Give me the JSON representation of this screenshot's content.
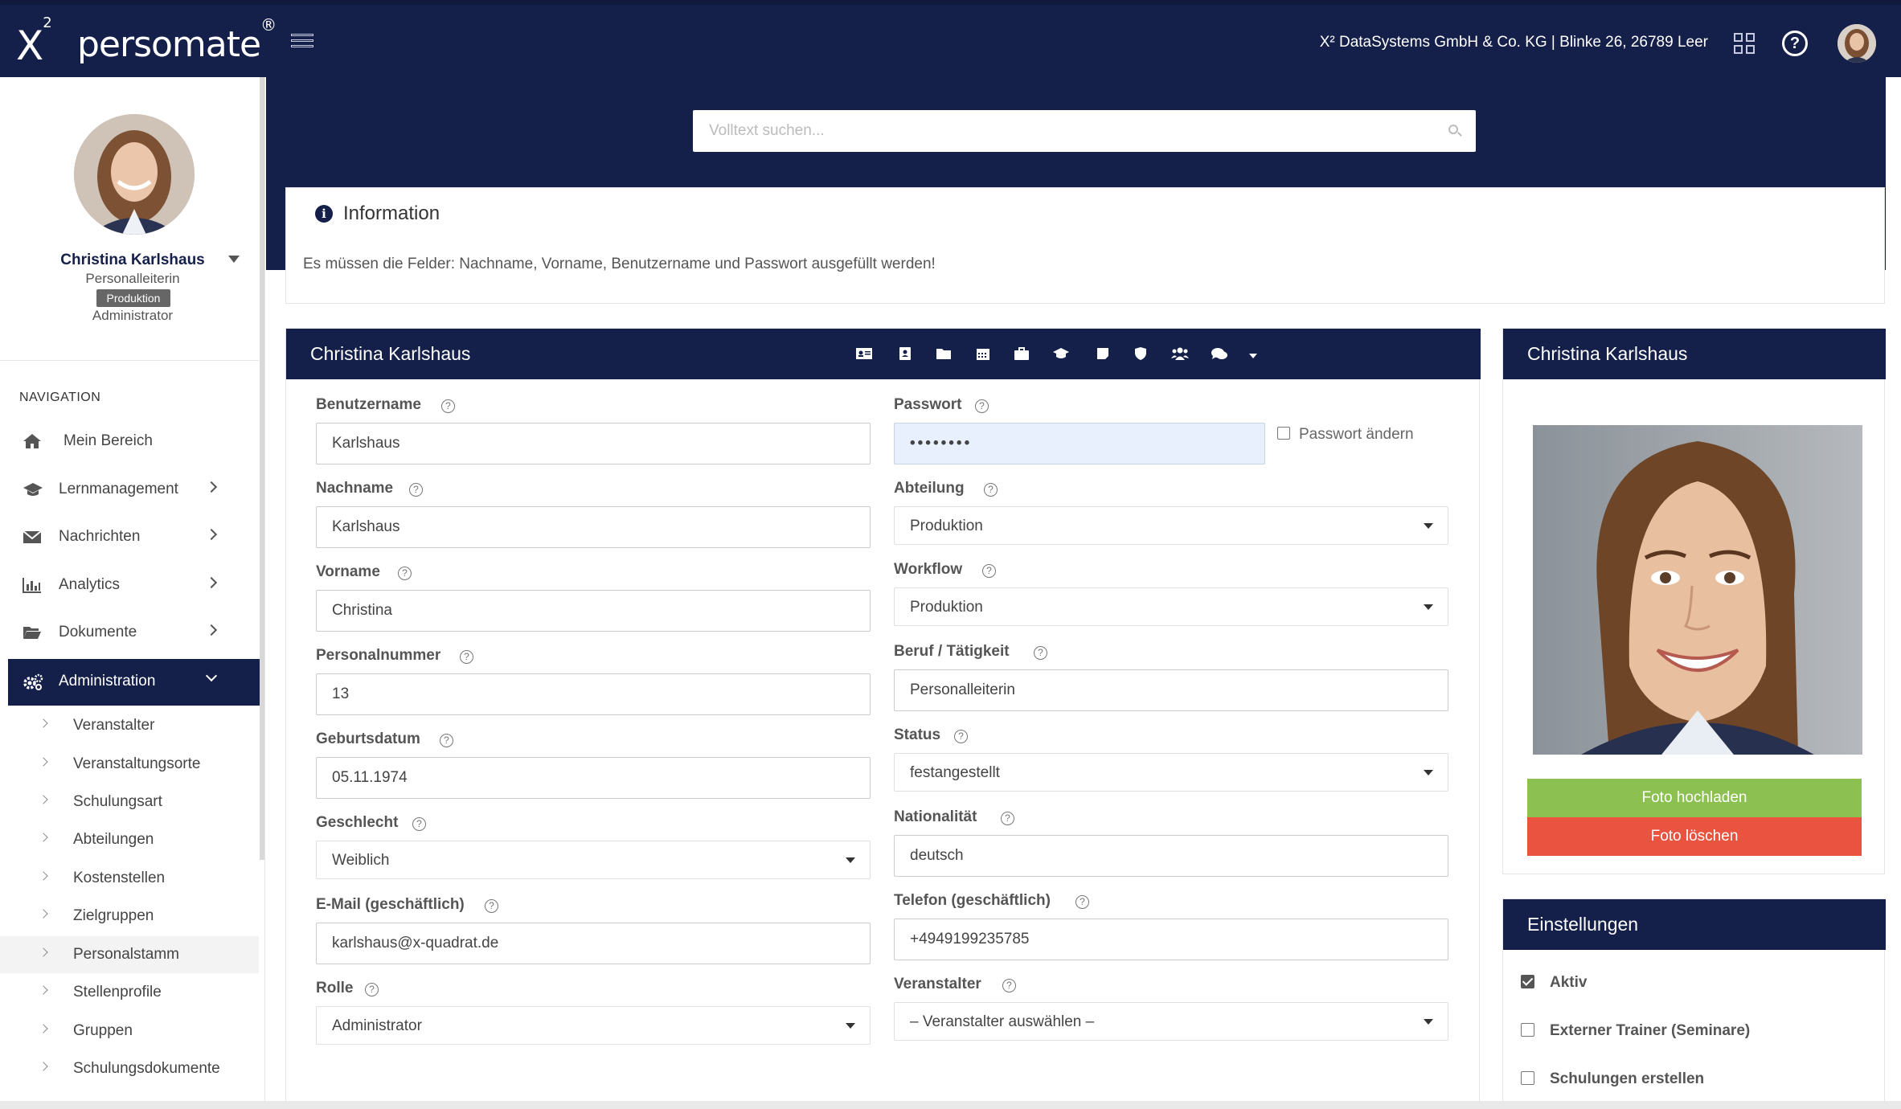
{
  "topbar": {
    "logo": "X",
    "logo_sup": "2",
    "brand": "persomate",
    "brand_mark": "®",
    "company": "X² DataSystems GmbH & Co. KG | Blinke 26, 26789 Leer",
    "help_glyph": "?"
  },
  "profile": {
    "name": "Christina Karlshaus",
    "role": "Personalleiterin",
    "badge": "Produktion",
    "access": "Administrator"
  },
  "navigation": {
    "title": "NAVIGATION",
    "items": [
      {
        "label": "Mein Bereich",
        "icon": "home-icon"
      },
      {
        "label": "Lernmanagement",
        "icon": "graduation-cap-icon"
      },
      {
        "label": "Nachrichten",
        "icon": "envelope-icon"
      },
      {
        "label": "Analytics",
        "icon": "bar-chart-icon"
      },
      {
        "label": "Dokumente",
        "icon": "folder-open-icon"
      },
      {
        "label": "Administration",
        "icon": "cogs-icon"
      }
    ],
    "subitems": [
      "Veranstalter",
      "Veranstaltungsorte",
      "Schulungsart",
      "Abteilungen",
      "Kostenstellen",
      "Zielgruppen",
      "Personalstamm",
      "Stellenprofile",
      "Gruppen",
      "Schulungsdokumente"
    ],
    "selected_subitem": "Personalstamm"
  },
  "search": {
    "placeholder": "Volltext suchen..."
  },
  "info": {
    "icon_glyph": "i",
    "title": "Information",
    "text": "Es müssen die Felder: Nachname, Vorname, Benutzername und Passwort ausgefüllt werden!"
  },
  "form": {
    "title": "Christina Karlshaus",
    "help_glyph": "?",
    "tab_icons": [
      "id-card-icon",
      "contact-book-icon",
      "folder-icon",
      "calendar-icon",
      "briefcase-icon",
      "graduation-cap-icon",
      "sticky-note-icon",
      "shield-icon",
      "users-icon",
      "comments-icon",
      "caret-down-icon"
    ],
    "left": {
      "benutzername": {
        "label": "Benutzername",
        "value": "Karlshaus"
      },
      "nachname": {
        "label": "Nachname",
        "value": "Karlshaus"
      },
      "vorname": {
        "label": "Vorname",
        "value": "Christina"
      },
      "personalnummer": {
        "label": "Personalnummer",
        "value": "13"
      },
      "geburtsdatum": {
        "label": "Geburtsdatum",
        "value": "05.11.1974"
      },
      "geschlecht": {
        "label": "Geschlecht",
        "value": "Weiblich"
      },
      "email": {
        "label": "E-Mail (geschäftlich)",
        "value": "karlshaus@x-quadrat.de"
      },
      "rolle": {
        "label": "Rolle",
        "value": "Administrator"
      }
    },
    "right": {
      "passwort": {
        "label": "Passwort",
        "value": "••••••••",
        "change_label": "Passwort ändern",
        "change_checked": false
      },
      "abteilung": {
        "label": "Abteilung",
        "value": "Produktion"
      },
      "workflow": {
        "label": "Workflow",
        "value": "Produktion"
      },
      "beruf": {
        "label": "Beruf / Tätigkeit",
        "value": "Personalleiterin"
      },
      "status": {
        "label": "Status",
        "value": "festangestellt"
      },
      "nationalitaet": {
        "label": "Nationalität",
        "value": "deutsch"
      },
      "telefon": {
        "label": "Telefon (geschäftlich)",
        "value": "+4949199235785"
      },
      "veranstalter": {
        "label": "Veranstalter",
        "value": "– Veranstalter auswählen –"
      }
    }
  },
  "photo_panel": {
    "title": "Christina Karlshaus",
    "upload_label": "Foto hochladen",
    "delete_label": "Foto löschen"
  },
  "settings": {
    "title": "Einstellungen",
    "items": [
      {
        "label": "Aktiv",
        "checked": true
      },
      {
        "label": "Externer Trainer (Seminare)",
        "checked": false
      },
      {
        "label": "Schulungen erstellen",
        "checked": false
      }
    ]
  },
  "colors": {
    "navy": "#15204a",
    "upload_green": "#8cc152",
    "delete_red": "#e9533f",
    "password_bg": "#e8f0fe"
  }
}
